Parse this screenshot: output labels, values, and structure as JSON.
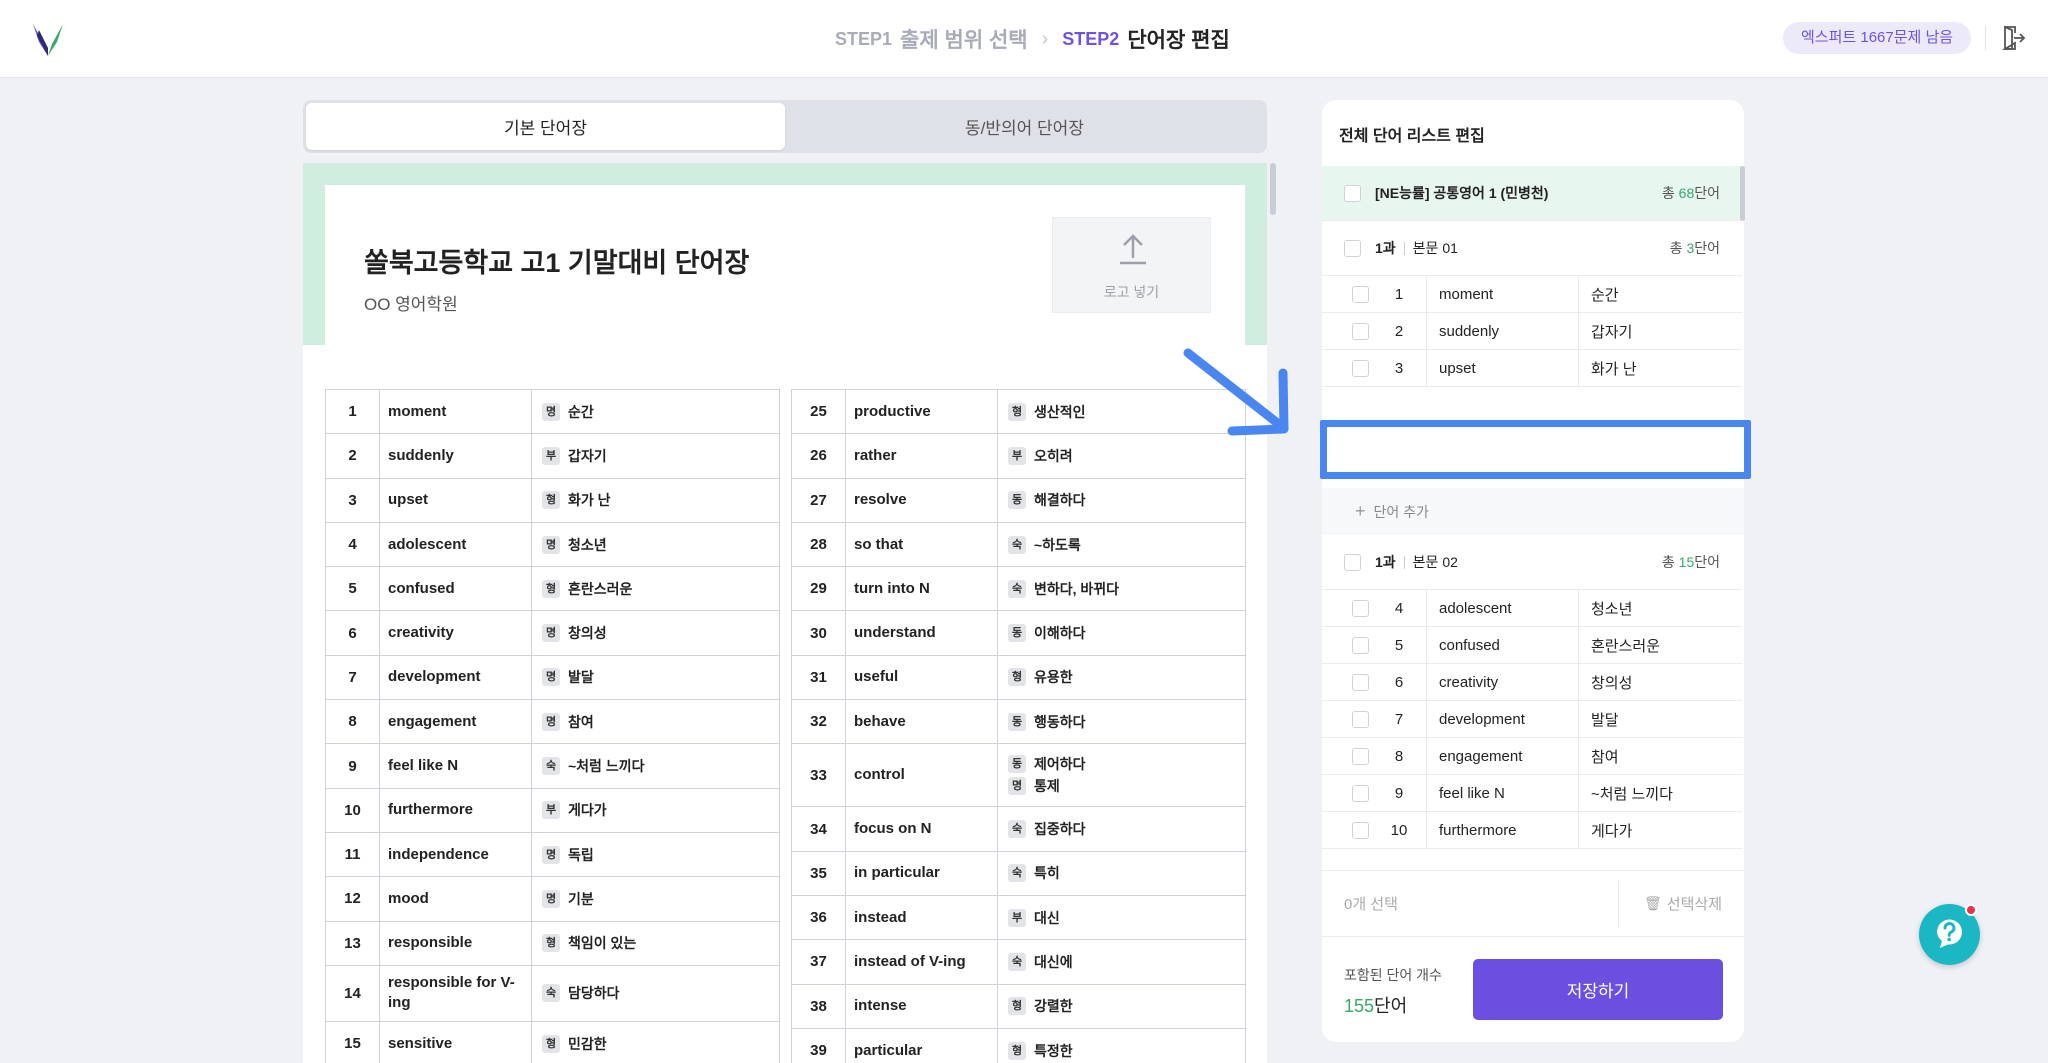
{
  "colors": {
    "accent": "#6a4fe0",
    "green": "#3aa86a",
    "band": "#cfeee0",
    "highlight": "#4a86f0",
    "help": "#1bb7c4"
  },
  "header": {
    "logo_icon": "brand-v-logo",
    "step1_num": "STEP1",
    "step1_label": "출제 범위 선택",
    "step2_num": "STEP2",
    "step2_label": "단어장 편집",
    "step_chevron": "›",
    "badge": "엑스퍼트 1667문제 남음",
    "exit_icon": "exit-icon"
  },
  "tabs": {
    "basic": "기본 단어장",
    "synonym": "동/반의어 단어장"
  },
  "document": {
    "title": "쏠북고등학교 고1 기말대비 단어장",
    "subtitle": "OO 영어학원",
    "logo_upload_label": "로고 넣기"
  },
  "word_table_left": [
    {
      "n": "1",
      "w": "moment",
      "m": [
        {
          "p": "명",
          "t": "순간"
        }
      ]
    },
    {
      "n": "2",
      "w": "suddenly",
      "m": [
        {
          "p": "부",
          "t": "갑자기"
        }
      ]
    },
    {
      "n": "3",
      "w": "upset",
      "m": [
        {
          "p": "형",
          "t": "화가 난"
        }
      ]
    },
    {
      "n": "4",
      "w": "adolescent",
      "m": [
        {
          "p": "명",
          "t": "청소년"
        }
      ]
    },
    {
      "n": "5",
      "w": "confused",
      "m": [
        {
          "p": "형",
          "t": "혼란스러운"
        }
      ]
    },
    {
      "n": "6",
      "w": "creativity",
      "m": [
        {
          "p": "명",
          "t": "창의성"
        }
      ]
    },
    {
      "n": "7",
      "w": "development",
      "m": [
        {
          "p": "명",
          "t": "발달"
        }
      ]
    },
    {
      "n": "8",
      "w": "engagement",
      "m": [
        {
          "p": "명",
          "t": "참여"
        }
      ]
    },
    {
      "n": "9",
      "w": "feel like N",
      "m": [
        {
          "p": "숙",
          "t": "~처럼 느끼다"
        }
      ]
    },
    {
      "n": "10",
      "w": "furthermore",
      "m": [
        {
          "p": "부",
          "t": "게다가"
        }
      ]
    },
    {
      "n": "11",
      "w": "independence",
      "m": [
        {
          "p": "명",
          "t": "독립"
        }
      ]
    },
    {
      "n": "12",
      "w": "mood",
      "m": [
        {
          "p": "명",
          "t": "기분"
        }
      ]
    },
    {
      "n": "13",
      "w": "responsible",
      "m": [
        {
          "p": "형",
          "t": "책임이 있는"
        }
      ]
    },
    {
      "n": "14",
      "w": "responsible for V-ing",
      "m": [
        {
          "p": "숙",
          "t": "담당하다"
        }
      ]
    },
    {
      "n": "15",
      "w": "sensitive",
      "m": [
        {
          "p": "형",
          "t": "민감한"
        }
      ]
    }
  ],
  "word_table_right": [
    {
      "n": "25",
      "w": "productive",
      "m": [
        {
          "p": "형",
          "t": "생산적인"
        }
      ]
    },
    {
      "n": "26",
      "w": "rather",
      "m": [
        {
          "p": "부",
          "t": "오히려"
        }
      ]
    },
    {
      "n": "27",
      "w": "resolve",
      "m": [
        {
          "p": "동",
          "t": "해결하다"
        }
      ]
    },
    {
      "n": "28",
      "w": "so that",
      "m": [
        {
          "p": "숙",
          "t": "~하도록"
        }
      ]
    },
    {
      "n": "29",
      "w": "turn into N",
      "m": [
        {
          "p": "숙",
          "t": "변하다, 바뀌다"
        }
      ]
    },
    {
      "n": "30",
      "w": "understand",
      "m": [
        {
          "p": "동",
          "t": "이해하다"
        }
      ]
    },
    {
      "n": "31",
      "w": "useful",
      "m": [
        {
          "p": "형",
          "t": "유용한"
        }
      ]
    },
    {
      "n": "32",
      "w": "behave",
      "m": [
        {
          "p": "동",
          "t": "행동하다"
        }
      ]
    },
    {
      "n": "33",
      "w": "control",
      "m": [
        {
          "p": "동",
          "t": "제어하다"
        },
        {
          "p": "명",
          "t": "통제"
        }
      ]
    },
    {
      "n": "34",
      "w": "focus on N",
      "m": [
        {
          "p": "숙",
          "t": "집중하다"
        }
      ]
    },
    {
      "n": "35",
      "w": "in particular",
      "m": [
        {
          "p": "숙",
          "t": "특히"
        }
      ]
    },
    {
      "n": "36",
      "w": "instead",
      "m": [
        {
          "p": "부",
          "t": "대신"
        }
      ]
    },
    {
      "n": "37",
      "w": "instead of V-ing",
      "m": [
        {
          "p": "숙",
          "t": "대신에"
        }
      ]
    },
    {
      "n": "38",
      "w": "intense",
      "m": [
        {
          "p": "형",
          "t": "강렬한"
        }
      ]
    },
    {
      "n": "39",
      "w": "particular",
      "m": [
        {
          "p": "형",
          "t": "특정한"
        }
      ]
    }
  ],
  "panel": {
    "title": "전체 단어 리스트 편집",
    "group": {
      "title": "[NE능률] 공통영어 1 (민병천)",
      "total_pre": "총 ",
      "total_num": "68",
      "total_suf": "단어"
    },
    "lesson1": {
      "num": "1과",
      "title": "본문 01",
      "total_pre": "총 ",
      "total_num": "3",
      "total_suf": "단어"
    },
    "lesson1_words": [
      {
        "n": "1",
        "e": "moment",
        "k": "순간"
      },
      {
        "n": "2",
        "e": "suddenly",
        "k": "갑자기"
      },
      {
        "n": "3",
        "e": "upset",
        "k": "화가 난"
      }
    ],
    "add_word": "단어 추가",
    "lesson2": {
      "num": "1과",
      "title": "본문 02",
      "total_pre": "총 ",
      "total_num": "15",
      "total_suf": "단어"
    },
    "lesson2_words": [
      {
        "n": "4",
        "e": "adolescent",
        "k": "청소년"
      },
      {
        "n": "5",
        "e": "confused",
        "k": "혼란스러운"
      },
      {
        "n": "6",
        "e": "creativity",
        "k": "창의성"
      },
      {
        "n": "7",
        "e": "development",
        "k": "발달"
      },
      {
        "n": "8",
        "e": "engagement",
        "k": "참여"
      },
      {
        "n": "9",
        "e": "feel like N",
        "k": "~처럼 느끼다"
      },
      {
        "n": "10",
        "e": "furthermore",
        "k": "게다가"
      }
    ],
    "selected": "0개 선택",
    "delete_selected": "선택삭제",
    "count_label": "포함된 단어 개수",
    "count_num": "155",
    "count_suffix": "단어",
    "save": "저장하기"
  }
}
